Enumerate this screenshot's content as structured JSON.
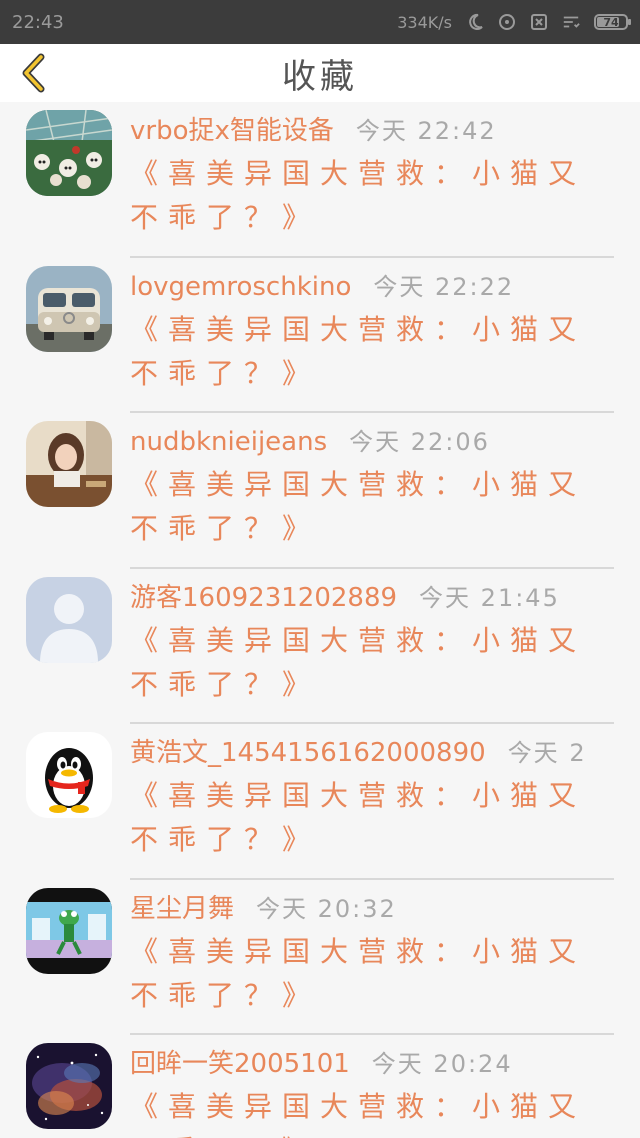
{
  "status_bar": {
    "time": "22:43",
    "network_speed": "334K/s",
    "battery_level": "74",
    "icons": [
      "moon-icon",
      "alarm-icon",
      "sim-icon",
      "signal-icon",
      "battery-icon"
    ]
  },
  "nav": {
    "back_icon": "chevron-left-icon",
    "title": "收藏"
  },
  "colors": {
    "accent": "#e8875a",
    "time_text": "#a9a9a9",
    "back_arrow": "#f2c430"
  },
  "items": [
    {
      "user": "vrbo捉x智能设备",
      "time": "今天 22:42",
      "title": "《喜美异国大营救：小猫又不乖了？》",
      "avatar": "greenhouse-lanterns-avatar"
    },
    {
      "user": "lovgemroschkino",
      "time": "今天 22:22",
      "title": "《喜美异国大营救：小猫又不乖了？》",
      "avatar": "vw-van-avatar"
    },
    {
      "user": "nudbknieijeans",
      "time": "今天 22:06",
      "title": "《喜美异国大营救：小猫又不乖了？》",
      "avatar": "girl-photo-avatar"
    },
    {
      "user": "游客1609231202889",
      "time": "今天 21:45",
      "title": "《喜美异国大营救：小猫又不乖了？》",
      "avatar": "default-person-avatar"
    },
    {
      "user": "黄浩文_1454156162000890",
      "time": "今天 2",
      "title": "《喜美异国大营救：小猫又不乖了？》",
      "avatar": "qq-penguin-avatar"
    },
    {
      "user": "星尘月舞",
      "time": "今天 20:32",
      "title": "《喜美异国大营救：小猫又不乖了？》",
      "avatar": "cartoon-frog-avatar"
    },
    {
      "user": "回眸一笑2005101",
      "time": "今天 20:24",
      "title": "《喜美异国大营救：小猫又不乖了？》",
      "avatar": "nebula-avatar"
    }
  ]
}
